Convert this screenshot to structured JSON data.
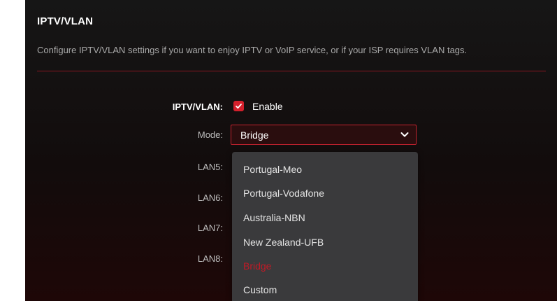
{
  "section": {
    "title": "IPTV/VLAN",
    "description": "Configure IPTV/VLAN settings if you want to enjoy IPTV or VoIP service, or if your ISP requires VLAN tags."
  },
  "iptv": {
    "label": "IPTV/VLAN:",
    "enable_label": "Enable",
    "enabled": true
  },
  "mode": {
    "label": "Mode:",
    "value": "Bridge",
    "options": [
      "Portugal-Meo",
      "Portugal-Vodafone",
      "Australia-NBN",
      "New Zealand-UFB",
      "Bridge",
      "Custom"
    ],
    "selected_index": 4
  },
  "lans": [
    "LAN5:",
    "LAN6:",
    "LAN7:",
    "LAN8:"
  ],
  "colors": {
    "accent": "#d4202c",
    "selected_option": "#c01a26",
    "divider": "#8a1620",
    "dropdown_bg": "#3a3a3c"
  },
  "icons": {
    "checkbox": "checkmark-icon",
    "select": "chevron-down-icon"
  }
}
